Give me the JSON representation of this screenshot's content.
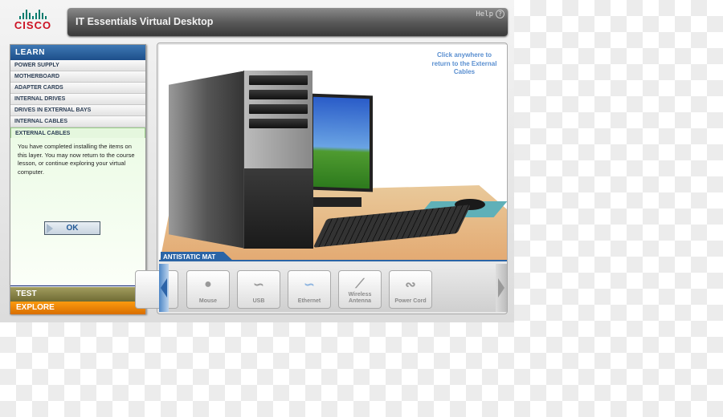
{
  "brand": {
    "logo": "CISCO"
  },
  "header": {
    "title": "IT Essentials Virtual Desktop",
    "help_label": "Help",
    "help_icon": "question-circle-icon"
  },
  "sidebar": {
    "section": "LEARN",
    "items": [
      {
        "label": "POWER SUPPLY"
      },
      {
        "label": "MOTHERBOARD"
      },
      {
        "label": "ADAPTER CARDS"
      },
      {
        "label": "INTERNAL DRIVES"
      },
      {
        "label": "DRIVES IN EXTERNAL BAYS"
      },
      {
        "label": "INTERNAL CABLES"
      },
      {
        "label": "EXTERNAL CABLES",
        "active": true
      }
    ],
    "message": "You have completed installing the items on this layer. You may now return to the course lesson, or continue exploring your virtual computer.",
    "ok_label": "OK",
    "test_label": "TEST",
    "explore_label": "EXPLORE"
  },
  "scene": {
    "hint": "Click anywhere to return to the External Cables",
    "mat_label": "ANTISTATIC MAT"
  },
  "tray": {
    "items": [
      {
        "label": "",
        "icon": "partial-item-icon"
      },
      {
        "label": "Mouse",
        "icon": "mouse-icon"
      },
      {
        "label": "USB",
        "icon": "usb-cable-icon"
      },
      {
        "label": "Ethernet",
        "icon": "ethernet-cable-icon"
      },
      {
        "label": "Wireless Antenna",
        "icon": "antenna-icon"
      },
      {
        "label": "Power Cord",
        "icon": "power-cord-icon"
      }
    ]
  },
  "colors": {
    "learn": "#1d4f8a",
    "test": "#6f6b34",
    "explore": "#e57a00",
    "active_item": "#e5f7de",
    "hint": "#5a8fd0"
  }
}
